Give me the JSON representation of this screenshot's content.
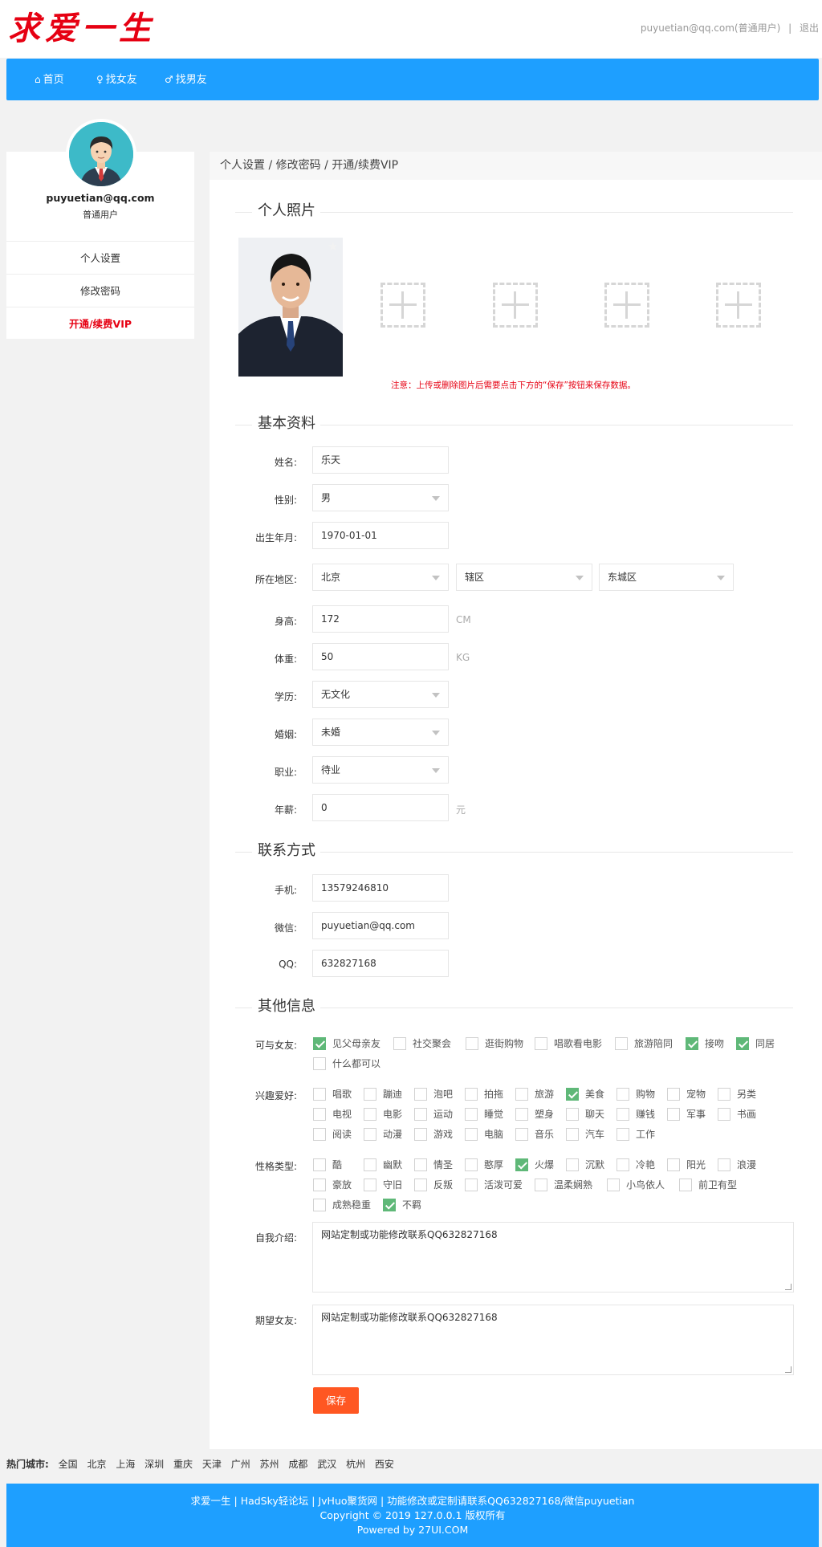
{
  "brand": {
    "logo_text": "求爱一生"
  },
  "header": {
    "user_label": "puyuetian@qq.com(普通用户)",
    "separator": "|",
    "logout": "退出"
  },
  "nav": {
    "items": [
      {
        "label": "首页"
      },
      {
        "label": "找女友"
      },
      {
        "label": "找男友"
      }
    ]
  },
  "sidebar": {
    "email": "puyuetian@qq.com",
    "role": "普通用户",
    "menu": [
      {
        "label": "个人设置"
      },
      {
        "label": "修改密码"
      },
      {
        "label": "开通/续费VIP"
      }
    ]
  },
  "breadcrumb": {
    "text": "个人设置 / 修改密码 / 开通/续费VIP"
  },
  "sections": {
    "photos": "个人照片",
    "basic": "基本资料",
    "contact": "联系方式",
    "other": "其他信息"
  },
  "photo_notice": "注意：上传或删除图片后需要点击下方的“保存”按钮来保存数据。",
  "basic": {
    "name": {
      "label": "姓名:",
      "value": "乐天"
    },
    "gender": {
      "label": "性别:",
      "value": "男"
    },
    "birth": {
      "label": "出生年月:",
      "value": "1970-01-01"
    },
    "region": {
      "label": "所在地区:",
      "province": "北京",
      "city": "辖区",
      "district": "东城区"
    },
    "height": {
      "label": "身高:",
      "value": "172",
      "unit": "CM"
    },
    "weight": {
      "label": "体重:",
      "value": "50",
      "unit": "KG"
    },
    "education": {
      "label": "学历:",
      "value": "无文化"
    },
    "marriage": {
      "label": "婚姻:",
      "value": "未婚"
    },
    "job": {
      "label": "职业:",
      "value": "待业"
    },
    "salary": {
      "label": "年薪:",
      "value": "0",
      "unit": "元"
    }
  },
  "contact": {
    "phone": {
      "label": "手机:",
      "value": "13579246810"
    },
    "wechat": {
      "label": "微信:",
      "value": "puyuetian@qq.com"
    },
    "qq": {
      "label": "QQ:",
      "value": "632827168"
    }
  },
  "other": {
    "with_partner": {
      "label": "可与女友:",
      "options": [
        {
          "label": "见父母亲友",
          "checked": true
        },
        {
          "label": "社交聚会",
          "checked": false
        },
        {
          "label": "逛街购物",
          "checked": false
        },
        {
          "label": "唱歌看电影",
          "checked": false
        },
        {
          "label": "旅游陪同",
          "checked": false
        },
        {
          "label": "接吻",
          "checked": true
        },
        {
          "label": "同居",
          "checked": true
        },
        {
          "label": "什么都可以",
          "checked": false
        }
      ]
    },
    "hobbies": {
      "label": "兴趣爱好:",
      "options": [
        {
          "label": "唱歌",
          "checked": false
        },
        {
          "label": "蹦迪",
          "checked": false
        },
        {
          "label": "泡吧",
          "checked": false
        },
        {
          "label": "拍拖",
          "checked": false
        },
        {
          "label": "旅游",
          "checked": false
        },
        {
          "label": "美食",
          "checked": true
        },
        {
          "label": "购物",
          "checked": false
        },
        {
          "label": "宠物",
          "checked": false
        },
        {
          "label": "另类",
          "checked": false
        },
        {
          "label": "电视",
          "checked": false
        },
        {
          "label": "电影",
          "checked": false
        },
        {
          "label": "运动",
          "checked": false
        },
        {
          "label": "睡觉",
          "checked": false
        },
        {
          "label": "塑身",
          "checked": false
        },
        {
          "label": "聊天",
          "checked": false
        },
        {
          "label": "赚钱",
          "checked": false
        },
        {
          "label": "军事",
          "checked": false
        },
        {
          "label": "书画",
          "checked": false
        },
        {
          "label": "阅读",
          "checked": false
        },
        {
          "label": "动漫",
          "checked": false
        },
        {
          "label": "游戏",
          "checked": false
        },
        {
          "label": "电脑",
          "checked": false
        },
        {
          "label": "音乐",
          "checked": false
        },
        {
          "label": "汽车",
          "checked": false
        },
        {
          "label": "工作",
          "checked": false
        }
      ]
    },
    "personality": {
      "label": "性格类型:",
      "options": [
        {
          "label": "酷",
          "checked": false
        },
        {
          "label": "幽默",
          "checked": false
        },
        {
          "label": "情圣",
          "checked": false
        },
        {
          "label": "憨厚",
          "checked": false
        },
        {
          "label": "火爆",
          "checked": true
        },
        {
          "label": "沉默",
          "checked": false
        },
        {
          "label": "冷艳",
          "checked": false
        },
        {
          "label": "阳光",
          "checked": false
        },
        {
          "label": "浪漫",
          "checked": false
        },
        {
          "label": "豪放",
          "checked": false
        },
        {
          "label": "守旧",
          "checked": false
        },
        {
          "label": "反叛",
          "checked": false
        },
        {
          "label": "活泼可爱",
          "checked": false
        },
        {
          "label": "温柔娴熟",
          "checked": false
        },
        {
          "label": "小鸟依人",
          "checked": false
        },
        {
          "label": "前卫有型",
          "checked": false
        },
        {
          "label": "成熟稳重",
          "checked": false
        },
        {
          "label": "不羁",
          "checked": true
        }
      ]
    },
    "intro": {
      "label": "自我介绍:",
      "value": "网站定制或功能修改联系QQ632827168"
    },
    "expect": {
      "label": "期望女友:",
      "value": "网站定制或功能修改联系QQ632827168"
    }
  },
  "save_label": "保存",
  "hot_cities": {
    "label": "热门城市:",
    "cities": [
      "全国",
      "北京",
      "上海",
      "深圳",
      "重庆",
      "天津",
      "广州",
      "苏州",
      "成都",
      "武汉",
      "杭州",
      "西安"
    ]
  },
  "footer": {
    "line1": "求爱一生 | HadSky轻论坛 | JvHuo聚货网 | 功能修改或定制请联系QQ632827168/微信puyuetian",
    "line2": "Copyright © 2019 127.0.0.1 版权所有",
    "line3": "Powered by 27UI.COM"
  },
  "colors": {
    "primary": "#1e9fff",
    "accent": "#e60012",
    "save": "#ff5722",
    "checked": "#5fb878"
  }
}
